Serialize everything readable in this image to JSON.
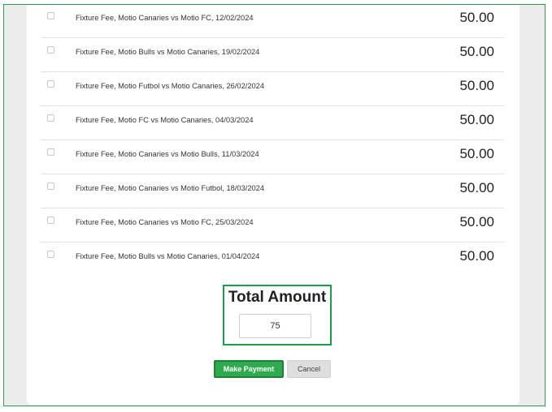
{
  "fees": [
    {
      "description": "Fixture Fee, Motio Canaries vs Motio FC, 12/02/2024",
      "amount": "50.00",
      "checked": false
    },
    {
      "description": "Fixture Fee, Motio Bulls vs Motio Canaries, 19/02/2024",
      "amount": "50.00",
      "checked": false
    },
    {
      "description": "Fixture Fee, Motio Futbol vs Motio Canaries, 26/02/2024",
      "amount": "50.00",
      "checked": false
    },
    {
      "description": "Fixture Fee, Motio FC vs Motio Canaries, 04/03/2024",
      "amount": "50.00",
      "checked": false
    },
    {
      "description": "Fixture Fee, Motio Canaries vs Motio Bulls, 11/03/2024",
      "amount": "50.00",
      "checked": false
    },
    {
      "description": "Fixture Fee, Motio Canaries vs Motio Futbol, 18/03/2024",
      "amount": "50.00",
      "checked": false
    },
    {
      "description": "Fixture Fee, Motio Canaries vs Motio FC, 25/03/2024",
      "amount": "50.00",
      "checked": false
    },
    {
      "description": "Fixture Fee, Motio Bulls vs Motio Canaries, 01/04/2024",
      "amount": "50.00",
      "checked": false
    }
  ],
  "total": {
    "label": "Total Amount",
    "value": "75"
  },
  "actions": {
    "pay_label": "Make Payment",
    "cancel_label": "Cancel"
  },
  "colors": {
    "accent": "#2faa4f",
    "highlight_border": "#1f9c49"
  }
}
